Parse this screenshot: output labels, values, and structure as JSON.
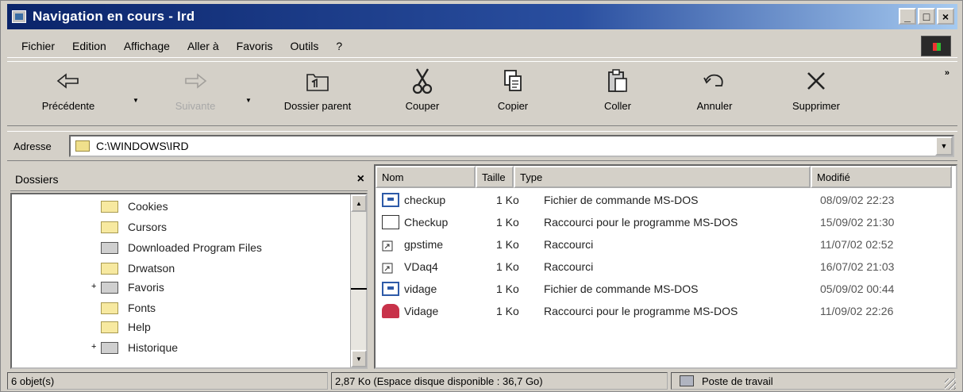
{
  "window": {
    "title": "Navigation en cours - Ird"
  },
  "menu": {
    "items": [
      "Fichier",
      "Edition",
      "Affichage",
      "Aller à",
      "Favoris",
      "Outils",
      "?"
    ]
  },
  "toolbar": {
    "back": "Précédente",
    "forward": "Suivante",
    "parent": "Dossier parent",
    "cut": "Couper",
    "copy": "Copier",
    "paste": "Coller",
    "undo": "Annuler",
    "delete": "Supprimer",
    "more": "»"
  },
  "address": {
    "label": "Adresse",
    "value": "C:\\WINDOWS\\IRD"
  },
  "folders": {
    "title": "Dossiers",
    "close": "×",
    "items": [
      {
        "label": "Cookies",
        "icon": "folder-icon",
        "expander": ""
      },
      {
        "label": "Cursors",
        "icon": "folder-icon",
        "expander": ""
      },
      {
        "label": "Downloaded Program Files",
        "icon": "special-folder-icon",
        "expander": ""
      },
      {
        "label": "Drwatson",
        "icon": "folder-icon",
        "expander": ""
      },
      {
        "label": "Favoris",
        "icon": "special-folder-icon",
        "expander": "+"
      },
      {
        "label": "Fonts",
        "icon": "folder-icon",
        "expander": ""
      },
      {
        "label": "Help",
        "icon": "folder-icon",
        "expander": ""
      },
      {
        "label": "Historique",
        "icon": "special-folder-icon",
        "expander": "+"
      }
    ]
  },
  "files": {
    "columns": {
      "name": "Nom",
      "size": "Taille",
      "type": "Type",
      "modified": "Modifié"
    },
    "rows": [
      {
        "name": "checkup",
        "size": "1 Ko",
        "type": "Fichier de commande MS-DOS",
        "modified": "08/09/02 22:23",
        "icon": "batch-file-icon"
      },
      {
        "name": "Checkup",
        "size": "1 Ko",
        "type": "Raccourci pour le programme MS-DOS",
        "modified": "15/09/02 21:30",
        "icon": "msdos-shortcut-icon"
      },
      {
        "name": "gpstime",
        "size": "1 Ko",
        "type": "Raccourci",
        "modified": "11/07/02 02:52",
        "icon": "shortcut-icon"
      },
      {
        "name": "VDaq4",
        "size": "1 Ko",
        "type": "Raccourci",
        "modified": "16/07/02 21:03",
        "icon": "shortcut-icon"
      },
      {
        "name": "vidage",
        "size": "1 Ko",
        "type": "Fichier de commande MS-DOS",
        "modified": "05/09/02 00:44",
        "icon": "batch-file-icon"
      },
      {
        "name": "Vidage",
        "size": "1 Ko",
        "type": "Raccourci pour le programme MS-DOS",
        "modified": "11/09/02 22:26",
        "icon": "msdos-shortcut-icon"
      }
    ]
  },
  "status": {
    "count": "6 objet(s)",
    "disk": "2,87 Ko (Espace disque disponible : 36,7 Go)",
    "zone": "Poste de travail"
  }
}
